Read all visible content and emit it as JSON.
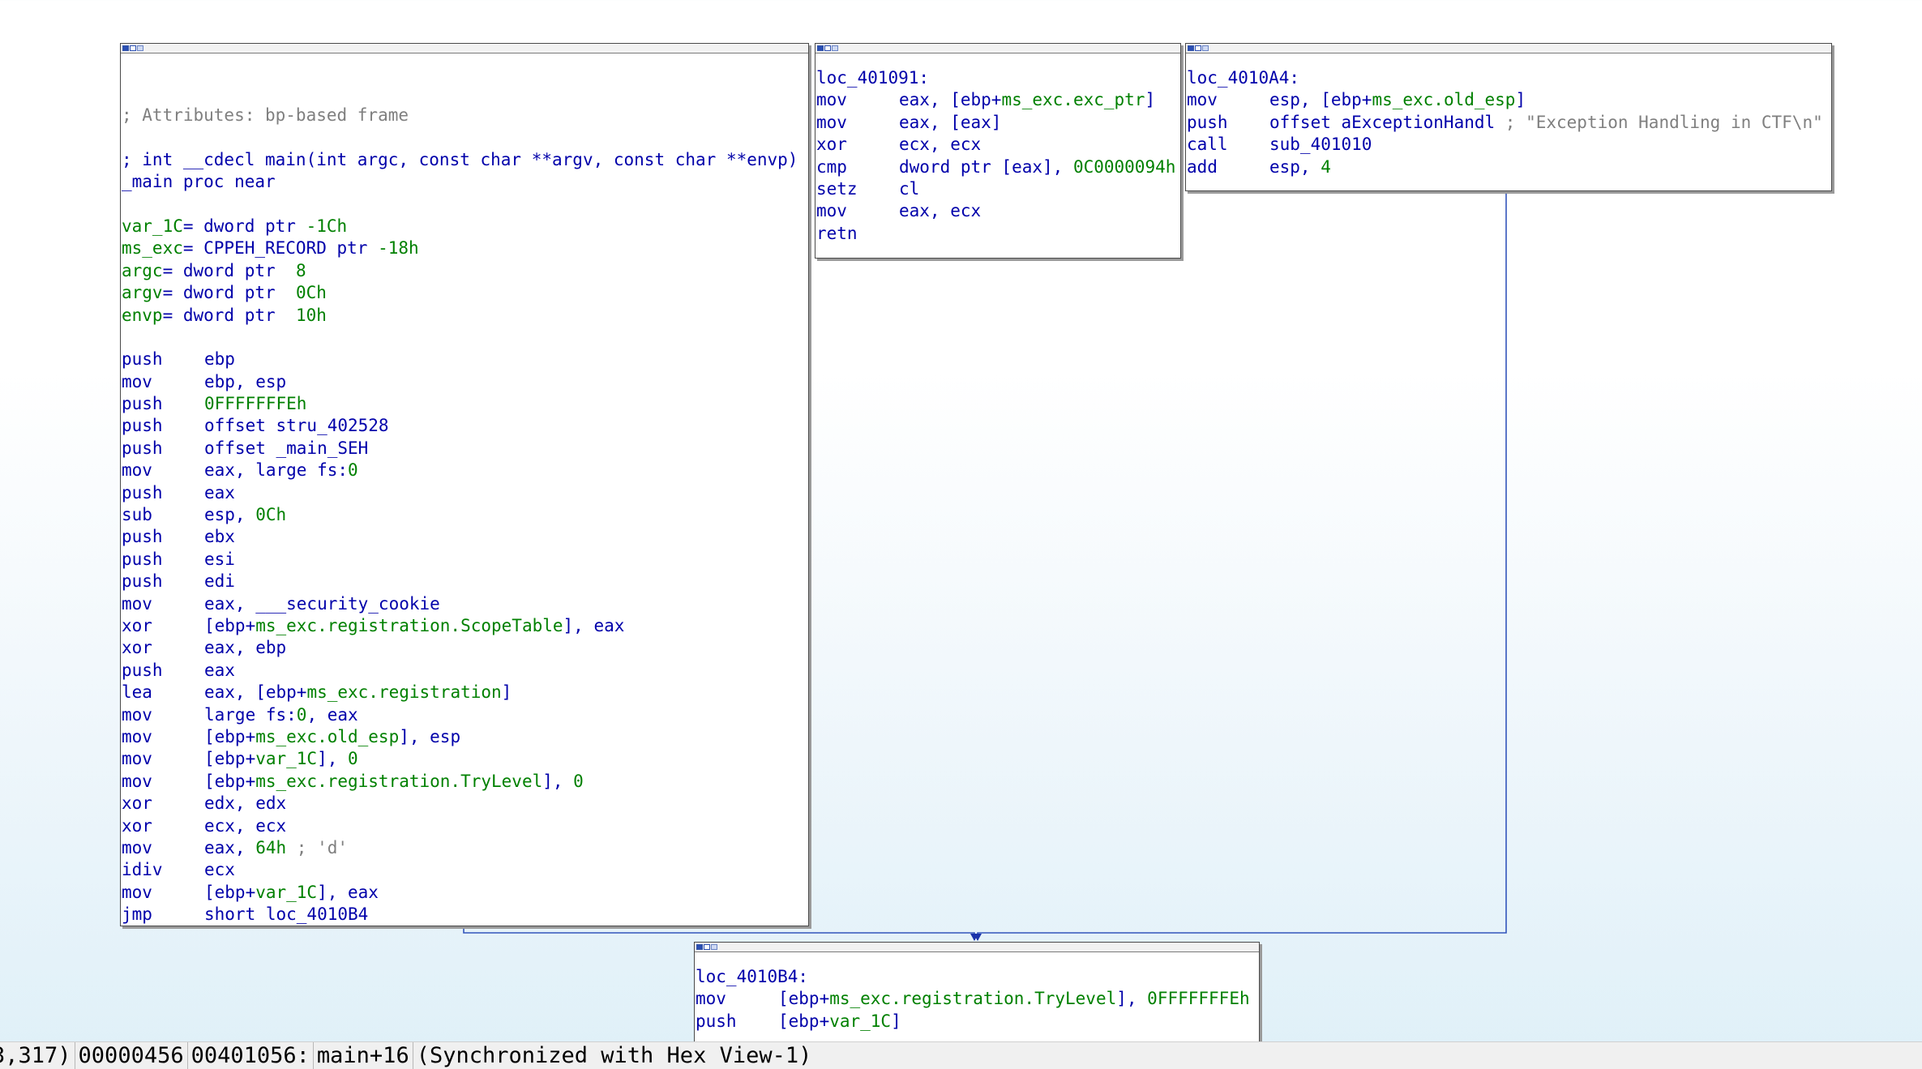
{
  "colors": {
    "mnemonic": "#0000aa",
    "comment": "#7f7f7f",
    "number": "#008000",
    "edge": "#3355bb",
    "arrow": "#1a33aa"
  },
  "icons": [
    "graph-node-titlebar-icons"
  ],
  "blocks": {
    "main": {
      "lines": [
        {
          "comment": "; Attributes: bp-based frame"
        },
        {},
        {
          "text": "; int __cdecl main(int argc, const char **argv, const char **envp)"
        },
        {
          "text": "_main proc near"
        },
        {},
        {
          "var": "var_1C",
          "rest": "= dword ptr ",
          "num": "-1Ch"
        },
        {
          "var": "ms_exc",
          "rest": "= CPPEH_RECORD ptr ",
          "num": "-18h"
        },
        {
          "var": "argc",
          "rest": "= dword ptr  ",
          "num": "8"
        },
        {
          "var": "argv",
          "rest": "= dword ptr  ",
          "num": "0Ch"
        },
        {
          "var": "envp",
          "rest": "= dword ptr  ",
          "num": "10h"
        },
        {},
        {
          "mn": "push",
          "ops": "ebp"
        },
        {
          "mn": "mov",
          "ops": "ebp, esp"
        },
        {
          "mn": "push",
          "num": "0FFFFFFFEh"
        },
        {
          "mn": "push",
          "ops": "offset stru_402528"
        },
        {
          "mn": "push",
          "ops": "offset _main_SEH"
        },
        {
          "mn": "mov",
          "ops": "eax, large fs:",
          "num": "0"
        },
        {
          "mn": "push",
          "ops": "eax"
        },
        {
          "mn": "sub",
          "ops": "esp, ",
          "num": "0Ch"
        },
        {
          "mn": "push",
          "ops": "ebx"
        },
        {
          "mn": "push",
          "ops": "esi"
        },
        {
          "mn": "push",
          "ops": "edi"
        },
        {
          "mn": "mov",
          "ops": "eax, ___security_cookie"
        },
        {
          "mn": "xor",
          "ops": "[ebp+",
          "var": "ms_exc.registration.ScopeTable",
          "tail": "], eax"
        },
        {
          "mn": "xor",
          "ops": "eax, ebp"
        },
        {
          "mn": "push",
          "ops": "eax"
        },
        {
          "mn": "lea",
          "ops": "eax, [ebp+",
          "var": "ms_exc.registration",
          "tail": "]"
        },
        {
          "mn": "mov",
          "ops": "large fs:",
          "num": "0",
          "tail": ", eax"
        },
        {
          "mn": "mov",
          "ops": "[ebp+",
          "var": "ms_exc.old_esp",
          "tail": "], esp"
        },
        {
          "mn": "mov",
          "ops": "[ebp+",
          "var": "var_1C",
          "tail": "], ",
          "num2": "0"
        },
        {
          "mn": "mov",
          "ops": "[ebp+",
          "var": "ms_exc.registration.TryLevel",
          "tail": "], ",
          "num2": "0"
        },
        {
          "mn": "xor",
          "ops": "edx, edx"
        },
        {
          "mn": "xor",
          "ops": "ecx, ecx"
        },
        {
          "mn": "mov",
          "ops": "eax, ",
          "num": "64h",
          "comment": " ; 'd'"
        },
        {
          "mn": "idiv",
          "ops": "ecx"
        },
        {
          "mn": "mov",
          "ops": "[ebp+",
          "var": "var_1C",
          "tail": "], eax"
        },
        {
          "mn": "jmp",
          "ops": "short loc_4010B4"
        }
      ]
    },
    "filter": {
      "lines": [
        {
          "text": "loc_401091:"
        },
        {
          "mn": "mov",
          "ops": "eax, [ebp+",
          "var": "ms_exc.exc_ptr",
          "tail": "]"
        },
        {
          "mn": "mov",
          "ops": "eax, [eax]"
        },
        {
          "mn": "xor",
          "ops": "ecx, ecx"
        },
        {
          "mn": "cmp",
          "ops": "dword ptr [eax], ",
          "num": "0C0000094h"
        },
        {
          "mn": "setz",
          "ops": "cl"
        },
        {
          "mn": "mov",
          "ops": "eax, ecx"
        },
        {
          "mn": "retn"
        }
      ]
    },
    "handler": {
      "lines": [
        {
          "text": "loc_4010A4:"
        },
        {
          "mn": "mov",
          "ops": "esp, [ebp+",
          "var": "ms_exc.old_esp",
          "tail": "]"
        },
        {
          "mn": "push",
          "ops": "offset aExceptionHandl",
          "comment": " ; \"Exception Handling in CTF\\n\""
        },
        {
          "mn": "call",
          "ops": "sub_401010"
        },
        {
          "mn": "add",
          "ops": "esp, ",
          "num": "4"
        }
      ]
    },
    "end": {
      "lines": [
        {
          "text": "loc_4010B4:"
        },
        {
          "mn": "mov",
          "ops": "[ebp+",
          "var": "ms_exc.registration.TryLevel",
          "tail": "], ",
          "num2": "0FFFFFFFEh"
        },
        {
          "mn": "push",
          "ops": "[ebp+",
          "var": "var_1C",
          "tail": "]"
        }
      ]
    }
  },
  "status": {
    "coords": "3,317)",
    "file_offset": "00000456",
    "address": "00401056:",
    "location": "main+16",
    "sync": "(Synchronized with Hex View-1)"
  }
}
